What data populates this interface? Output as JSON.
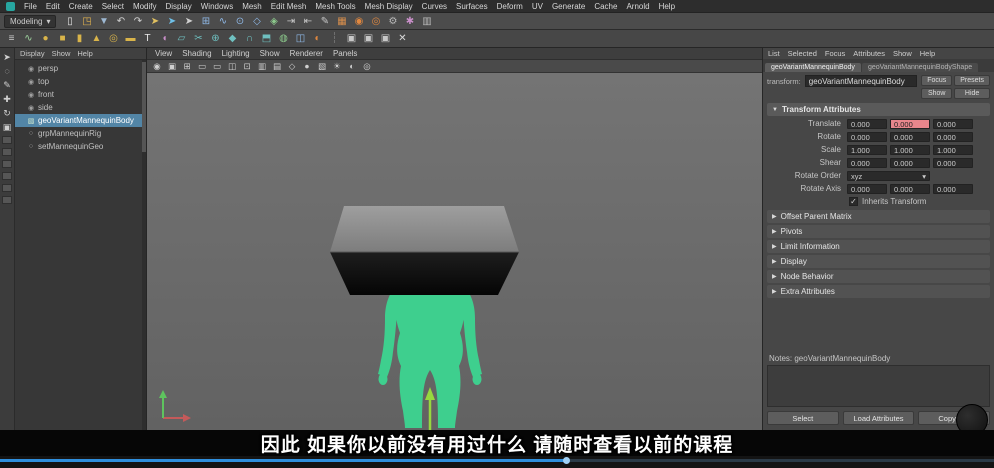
{
  "colors": {
    "selection": "#5285a6",
    "highlight_field": "#e8868c",
    "character_green": "#3ecf8e",
    "progress_blue": "#2f8fdd"
  },
  "ui": {
    "caret": "▾",
    "check": "✓",
    "arrow_down": "▼",
    "arrow_right": "▶"
  },
  "menubar": {
    "items": [
      "File",
      "Edit",
      "Create",
      "Select",
      "Modify",
      "Display",
      "Windows",
      "Mesh",
      "Edit Mesh",
      "Mesh Tools",
      "Mesh Display",
      "Curves",
      "Surfaces",
      "Deform",
      "UV",
      "Generate",
      "Cache",
      "Arnold",
      "Help"
    ]
  },
  "statusline": {
    "menu_set": "Modeling",
    "icons": [
      {
        "name": "scene-new-icon",
        "glyph": "▯",
        "color": "#e0e0e0"
      },
      {
        "name": "scene-open-icon",
        "glyph": "◳",
        "color": "#e3b34e"
      },
      {
        "name": "scene-save-icon",
        "glyph": "▼",
        "color": "#9db8d2"
      },
      {
        "name": "undo-icon",
        "glyph": "↶",
        "color": "#d0d0d0"
      },
      {
        "name": "redo-icon",
        "glyph": "↷",
        "color": "#d0d0d0"
      },
      {
        "name": "select-by-hierarchy-icon",
        "glyph": "➤",
        "color": "#e0c060"
      },
      {
        "name": "select-by-object-icon",
        "glyph": "➤",
        "color": "#6fc0e8"
      },
      {
        "name": "select-by-component-icon",
        "glyph": "➤",
        "color": "#d0d0d0"
      },
      {
        "name": "snap-grid-icon",
        "glyph": "⊞",
        "color": "#8fb9e8"
      },
      {
        "name": "snap-curve-icon",
        "glyph": "∿",
        "color": "#8fb9e8"
      },
      {
        "name": "snap-point-icon",
        "glyph": "⊙",
        "color": "#8fb9e8"
      },
      {
        "name": "snap-plane-icon",
        "glyph": "◇",
        "color": "#8fb9e8"
      },
      {
        "name": "make-live-icon",
        "glyph": "◈",
        "color": "#8cc98c"
      },
      {
        "name": "input-connections-icon",
        "glyph": "⇥",
        "color": "#c8c8c8"
      },
      {
        "name": "output-connections-icon",
        "glyph": "⇤",
        "color": "#c8c8c8"
      },
      {
        "name": "construction-history-icon",
        "glyph": "✎",
        "color": "#c8c8c8"
      },
      {
        "name": "open-render-view-icon",
        "glyph": "▦",
        "color": "#d98f4c"
      },
      {
        "name": "render-current-frame-icon",
        "glyph": "◉",
        "color": "#e0873f"
      },
      {
        "name": "ipr-render-icon",
        "glyph": "◎",
        "color": "#e0873f"
      },
      {
        "name": "render-settings-icon",
        "glyph": "⚙",
        "color": "#b9b9b9"
      },
      {
        "name": "paint-effects-icon",
        "glyph": "✱",
        "color": "#c98fc9"
      },
      {
        "name": "display-layer-icon",
        "glyph": "▥",
        "color": "#b9b9b9"
      }
    ]
  },
  "shelf": {
    "icons": [
      {
        "name": "shelf-menu-icon",
        "glyph": "≡",
        "color": "#cccccc"
      },
      {
        "name": "curves-icon",
        "glyph": "∿",
        "color": "#9fd49f"
      },
      {
        "name": "poly-sphere-icon",
        "glyph": "●",
        "color": "#d9b44a"
      },
      {
        "name": "poly-cube-icon",
        "glyph": "■",
        "color": "#d9b44a"
      },
      {
        "name": "poly-cylinder-icon",
        "glyph": "▮",
        "color": "#d9b44a"
      },
      {
        "name": "poly-cone-icon",
        "glyph": "▲",
        "color": "#d9b44a"
      },
      {
        "name": "poly-torus-icon",
        "glyph": "◎",
        "color": "#d9b44a"
      },
      {
        "name": "poly-plane-icon",
        "glyph": "▬",
        "color": "#d9b44a"
      },
      {
        "name": "poly-text-icon",
        "glyph": "T",
        "color": "#e8e8e8"
      },
      {
        "name": "sculpt-tool-icon",
        "glyph": "◖",
        "color": "#c98fc9"
      },
      {
        "name": "quad-draw-icon",
        "glyph": "▱",
        "color": "#6fc0c0"
      },
      {
        "name": "multi-cut-icon",
        "glyph": "✂",
        "color": "#6fc0c0"
      },
      {
        "name": "target-weld-icon",
        "glyph": "⊕",
        "color": "#6fc0c0"
      },
      {
        "name": "bevel-icon",
        "glyph": "◆",
        "color": "#6fc0c0"
      },
      {
        "name": "bridge-icon",
        "glyph": "∩",
        "color": "#6fc0c0"
      },
      {
        "name": "extrude-icon",
        "glyph": "⬒",
        "color": "#6fc0c0"
      },
      {
        "name": "smooth-icon",
        "glyph": "◍",
        "color": "#8cc98c"
      },
      {
        "name": "mirror-icon",
        "glyph": "◫",
        "color": "#8fb9e8"
      },
      {
        "name": "boolean-icon",
        "glyph": "◐",
        "color": "#e0873f"
      },
      {
        "name": "separator-icon",
        "glyph": "┆",
        "color": "#7a7a7a"
      },
      {
        "name": "modeling-toolkit-toggle-icon",
        "glyph": "▣",
        "color": "#c8c8c8"
      },
      {
        "name": "attribute-editor-toggle-icon",
        "glyph": "▣",
        "color": "#c8c8c8"
      },
      {
        "name": "channel-box-toggle-icon",
        "glyph": "▣",
        "color": "#c8c8c8"
      },
      {
        "name": "close-icon",
        "glyph": "✕",
        "color": "#d8d8d8"
      }
    ]
  },
  "toolbox": {
    "tools": [
      {
        "name": "select-tool-icon",
        "glyph": "➤"
      },
      {
        "name": "lasso-tool-icon",
        "glyph": "◌"
      },
      {
        "name": "paint-select-tool-icon",
        "glyph": "✎"
      },
      {
        "name": "move-tool-icon",
        "glyph": "✚"
      },
      {
        "name": "rotate-tool-icon",
        "glyph": "↻"
      },
      {
        "name": "scale-tool-icon",
        "glyph": "▣"
      }
    ]
  },
  "outliner": {
    "menu": [
      "Display",
      "Show",
      "Help"
    ],
    "items": [
      {
        "name": "outliner-item-persp",
        "label": "persp",
        "icon": "◉",
        "icon_color": "#a0a0a0",
        "state": ""
      },
      {
        "name": "outliner-item-top",
        "label": "top",
        "icon": "◉",
        "icon_color": "#a0a0a0",
        "state": ""
      },
      {
        "name": "outliner-item-front",
        "label": "front",
        "icon": "◉",
        "icon_color": "#a0a0a0",
        "state": ""
      },
      {
        "name": "outliner-item-side",
        "label": "side",
        "icon": "◉",
        "icon_color": "#a0a0a0",
        "state": ""
      },
      {
        "name": "outliner-item-geovariantmannequinbody",
        "label": "geoVariantMannequinBody",
        "icon": "▧",
        "icon_color": "#cfe8cf",
        "state": "selected"
      },
      {
        "name": "outliner-item-grpmannequinrig",
        "label": "grpMannequinRig",
        "icon": "○",
        "icon_color": "#a0a0a0",
        "state": ""
      },
      {
        "name": "outliner-item-setmannequingeo",
        "label": "setMannequinGeo",
        "icon": "○",
        "icon_color": "#a0a0a0",
        "state": ""
      }
    ]
  },
  "viewport": {
    "menu": [
      "View",
      "Shading",
      "Lighting",
      "Show",
      "Renderer",
      "Panels"
    ],
    "toolbar_icons": [
      {
        "name": "vp-select-camera-icon",
        "glyph": "◉"
      },
      {
        "name": "vp-lock-camera-icon",
        "glyph": "▣"
      },
      {
        "name": "vp-grid-icon",
        "glyph": "⊞"
      },
      {
        "name": "vp-film-gate-icon",
        "glyph": "▭"
      },
      {
        "name": "vp-resolution-gate-icon",
        "glyph": "▭"
      },
      {
        "name": "vp-gate-mask-icon",
        "glyph": "◫"
      },
      {
        "name": "vp-field-chart-icon",
        "glyph": "⊡"
      },
      {
        "name": "vp-safe-action-icon",
        "glyph": "▥"
      },
      {
        "name": "vp-safe-title-icon",
        "glyph": "▤"
      },
      {
        "name": "vp-wireframe-icon",
        "glyph": "◇"
      },
      {
        "name": "vp-shaded-icon",
        "glyph": "●"
      },
      {
        "name": "vp-textured-icon",
        "glyph": "▧"
      },
      {
        "name": "vp-lights-icon",
        "glyph": "☀"
      },
      {
        "name": "vp-shadows-icon",
        "glyph": "◐"
      },
      {
        "name": "vp-ao-icon",
        "glyph": "◎"
      }
    ]
  },
  "ae": {
    "menu": [
      "List",
      "Selected",
      "Focus",
      "Attributes",
      "Show",
      "Help"
    ],
    "tabs": [
      {
        "name": "ae-tab-transform",
        "label": "geoVariantMannequinBody",
        "state": "active"
      },
      {
        "name": "ae-tab-shape",
        "label": "geoVariantMannequinBodyShape",
        "state": ""
      }
    ],
    "node_type_label": "transform:",
    "node_name": "geoVariantMannequinBody",
    "buttons_top": {
      "focus": "Focus",
      "presets": "Presets",
      "show": "Show",
      "hide": "Hide"
    },
    "section_transform": "Transform Attributes",
    "rows": [
      {
        "label": "Translate",
        "values": [
          "0.000",
          "0.000",
          "0.000"
        ]
      },
      {
        "label": "Rotate",
        "values": [
          "0.000",
          "0.000",
          "0.000"
        ]
      },
      {
        "label": "Scale",
        "values": [
          "1.000",
          "1.000",
          "1.000"
        ]
      },
      {
        "label": "Shear",
        "values": [
          "0.000",
          "0.000",
          "0.000"
        ]
      }
    ],
    "rotate_order_label": "Rotate Order",
    "rotate_order_value": "xyz",
    "rotate_axis_label": "Rotate Axis",
    "rotate_axis_values": [
      "0.000",
      "0.000",
      "0.000"
    ],
    "inherits_label": "Inherits Transform",
    "sections": [
      "Offset Parent Matrix",
      "Pivots",
      "Limit Information",
      "Display",
      "Node Behavior",
      "Extra Attributes"
    ],
    "notes_label": "Notes: geoVariantMannequinBody",
    "buttons": {
      "select": "Select",
      "load": "Load Attributes",
      "copy": "Copy Tab"
    }
  },
  "subtitle": {
    "text": "因此 如果你以前没有用过什么 请随时查看以前的课程"
  },
  "player": {
    "progress_percent": 57
  }
}
